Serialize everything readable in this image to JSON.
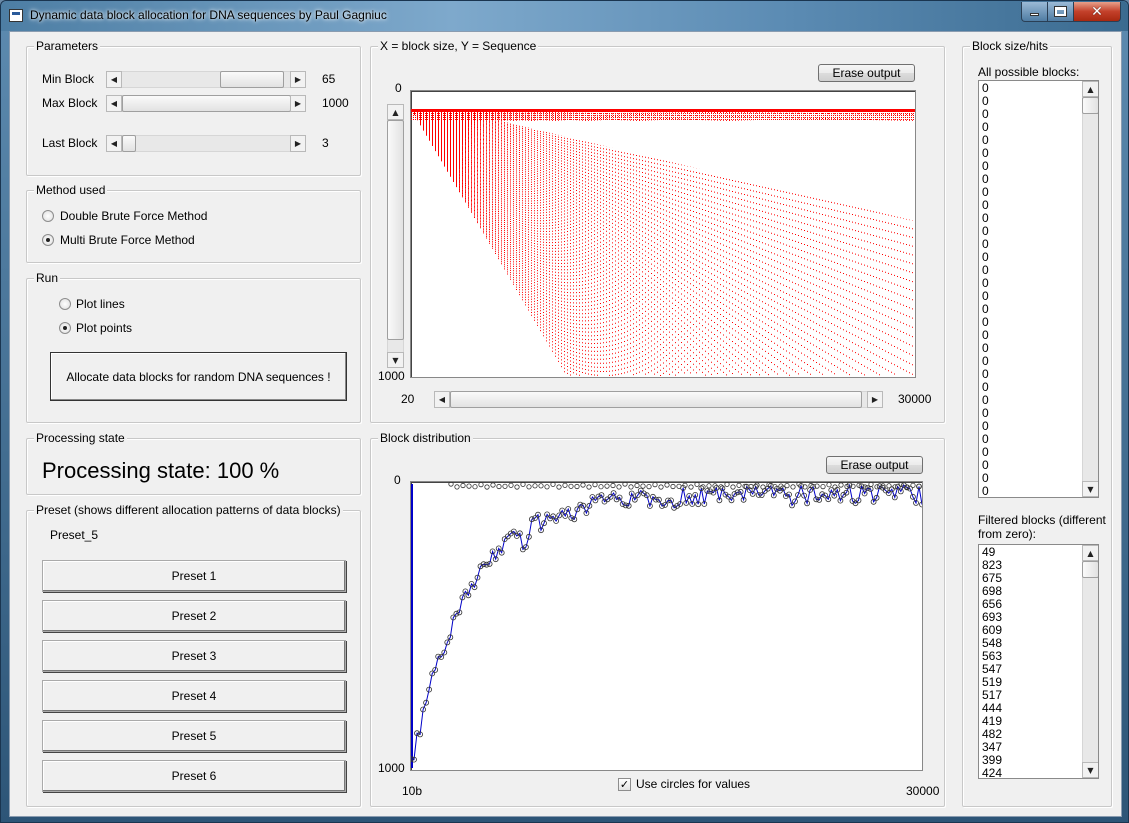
{
  "window": {
    "title": "Dynamic data block allocation for DNA sequences by Paul Gagniuc"
  },
  "parameters": {
    "label": "Parameters",
    "min_block": {
      "label": "Min Block",
      "value": "65",
      "position": 0.36
    },
    "max_block": {
      "label": "Max Block",
      "value": "1000",
      "position": 1.0
    },
    "last_block": {
      "label": "Last Block",
      "value": "3",
      "position": 0.0
    }
  },
  "method": {
    "label": "Method used",
    "options": [
      {
        "label": "Double Brute Force Method",
        "checked": false
      },
      {
        "label": "Multi Brute Force Method",
        "checked": true
      }
    ]
  },
  "run": {
    "label": "Run",
    "options": [
      {
        "label": "Plot lines",
        "checked": false
      },
      {
        "label": "Plot points",
        "checked": true
      }
    ],
    "allocate_button": "Allocate data blocks for random DNA sequences !"
  },
  "processing": {
    "label": "Processing state",
    "text": "Processing state: 100 %"
  },
  "preset": {
    "label": "Preset (shows different allocation patterns of data blocks)",
    "current": "Preset_5",
    "buttons": [
      "Preset 1",
      "Preset 2",
      "Preset 3",
      "Preset 4",
      "Preset 5",
      "Preset 6"
    ]
  },
  "top_plot": {
    "label": "X = block size, Y = Sequence",
    "erase_button": "Erase output",
    "y_top": "0",
    "y_bottom": "1000",
    "x_left": "20",
    "x_right": "30000",
    "colors": {
      "points": "#ff0000"
    }
  },
  "bottom_plot": {
    "label": "Block distribution",
    "erase_button": "Erase output",
    "y_top": "0",
    "y_bottom": "1000",
    "x_left": "10b",
    "x_right": "30000",
    "use_circles_label": "Use circles for values",
    "use_circles_checked": true,
    "colors": {
      "line": "#0000c8"
    }
  },
  "block_hits": {
    "label": "Block size/hits",
    "all_label": "All possible blocks:",
    "all_items": [
      "0",
      "0",
      "0",
      "0",
      "0",
      "0",
      "0",
      "0",
      "0",
      "0",
      "0",
      "0",
      "0",
      "0",
      "0",
      "0",
      "0",
      "0",
      "0",
      "0",
      "0",
      "0",
      "0",
      "0",
      "0",
      "0",
      "0",
      "0",
      "0",
      "0",
      "0",
      "0"
    ],
    "filtered_label_1": "Filtered blocks (different",
    "filtered_label_2": "from zero):",
    "filtered_items": [
      "49",
      "823",
      "675",
      "698",
      "656",
      "693",
      "609",
      "548",
      "563",
      "547",
      "519",
      "517",
      "444",
      "419",
      "482",
      "347",
      "399",
      "424"
    ]
  }
}
